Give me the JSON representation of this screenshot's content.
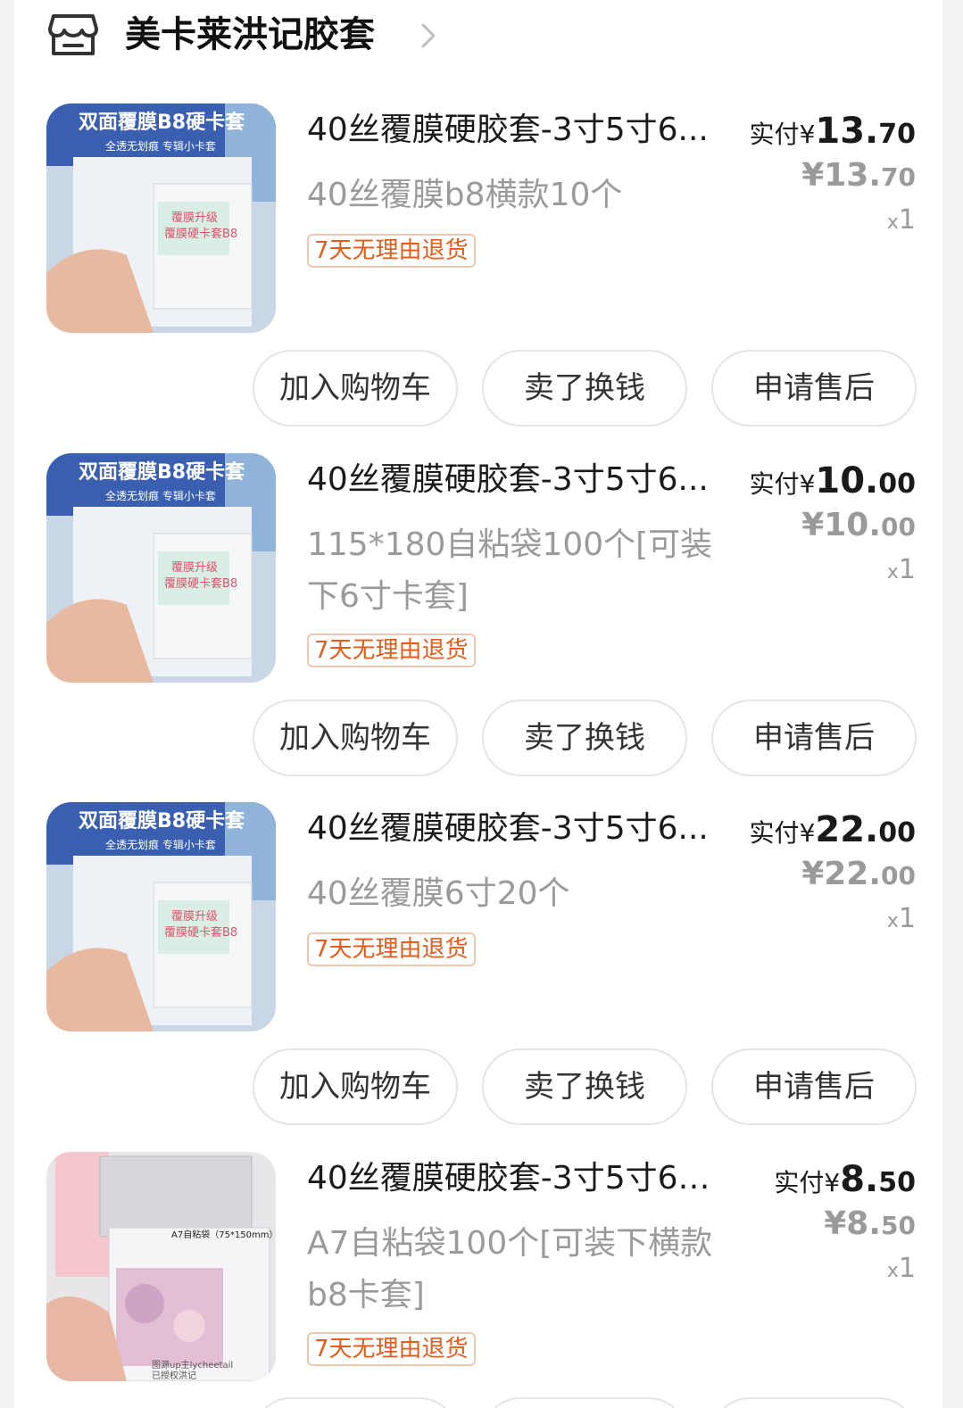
{
  "shop": {
    "name": "美卡莱洪记胶套",
    "icon": "store-icon"
  },
  "buttons": {
    "add_cart": "加入购物车",
    "sell": "卖了换钱",
    "after_sale": "申请售后"
  },
  "paid_label": "实付",
  "currency": "¥",
  "accent_color": "#e25d1c",
  "items": [
    {
      "title": "40丝覆膜硬胶套-3寸5寸6...",
      "spec": "40丝覆膜b8横款10个",
      "tag": "7天无理由退货",
      "paid_int": "13.",
      "paid_dec": "70",
      "price_int": "13.",
      "price_dec": "70",
      "qty_x": "x",
      "qty": "1",
      "image_text": {
        "line1": "双面覆膜B8硬卡套",
        "line2": "全透无划痕 专辑小卡套",
        "line3": "覆膜升级",
        "line4": "覆膜硬卡套B8"
      }
    },
    {
      "title": "40丝覆膜硬胶套-3寸5寸6...",
      "spec": "115*180自粘袋100个[可装下6寸卡套]",
      "tag": "7天无理由退货",
      "paid_int": "10.",
      "paid_dec": "00",
      "price_int": "10.",
      "price_dec": "00",
      "qty_x": "x",
      "qty": "1",
      "image_text": {
        "line1": "双面覆膜B8硬卡套",
        "line2": "全透无划痕 专辑小卡套",
        "line3": "覆膜升级",
        "line4": "覆膜硬卡套B8"
      }
    },
    {
      "title": "40丝覆膜硬胶套-3寸5寸6...",
      "spec": "40丝覆膜6寸20个",
      "tag": "7天无理由退货",
      "paid_int": "22.",
      "paid_dec": "00",
      "price_int": "22.",
      "price_dec": "00",
      "qty_x": "x",
      "qty": "1",
      "image_text": {
        "line1": "双面覆膜B8硬卡套",
        "line2": "全透无划痕 专辑小卡套",
        "line3": "覆膜升级",
        "line4": "覆膜硬卡套B8"
      }
    },
    {
      "title": "40丝覆膜硬胶套-3寸5寸6寸...",
      "spec": "A7自粘袋100个[可装下横款b8卡套]",
      "tag": "7天无理由退货",
      "paid_int": "8.",
      "paid_dec": "50",
      "price_int": "8.",
      "price_dec": "50",
      "qty_x": "x",
      "qty": "1",
      "image_text": {
        "label": "A7自粘袋（75*150mm）",
        "watermark1": "图源up主lycheetail",
        "watermark2": "已授权洪记"
      }
    }
  ]
}
